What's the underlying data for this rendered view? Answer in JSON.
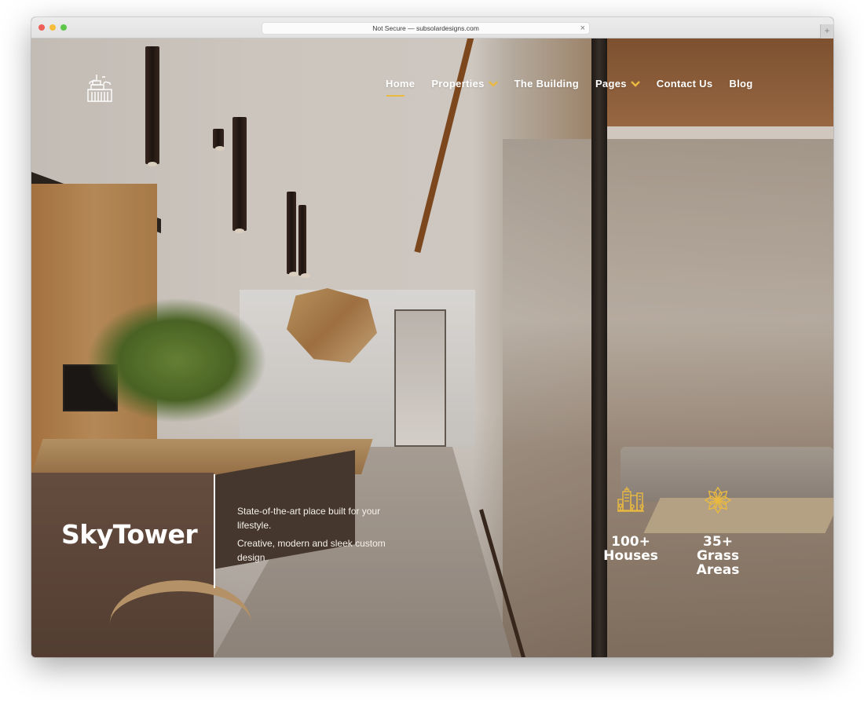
{
  "browser": {
    "url_text": "Not Secure — subsolardesigns.com",
    "close_glyph": "×",
    "new_tab_glyph": "+"
  },
  "site": {
    "logo_icon": "skyscraper-logo-icon",
    "nav": [
      {
        "label": "Home",
        "active": true,
        "has_dropdown": false
      },
      {
        "label": "Properties",
        "active": false,
        "has_dropdown": true
      },
      {
        "label": "The Building",
        "active": false,
        "has_dropdown": false
      },
      {
        "label": "Pages",
        "active": false,
        "has_dropdown": true
      },
      {
        "label": "Contact Us",
        "active": false,
        "has_dropdown": false
      },
      {
        "label": "Blog",
        "active": false,
        "has_dropdown": false
      }
    ],
    "accent_color": "#e9b940"
  },
  "hero": {
    "title": "SkyTower",
    "tagline_1": "State-of-the-art place built for your lifestyle.",
    "tagline_2": "Creative, modern and sleek custom design",
    "stats": [
      {
        "icon": "city-buildings-icon",
        "number": "100+",
        "label": "Houses"
      },
      {
        "icon": "flower-icon",
        "number": "35+",
        "label": "Grass Areas"
      }
    ]
  }
}
